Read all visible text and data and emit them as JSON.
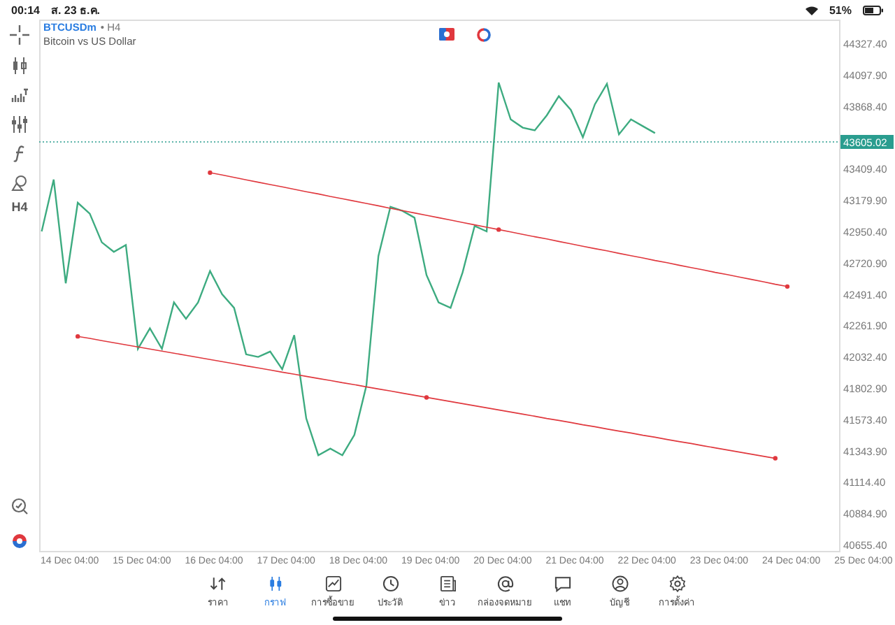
{
  "status_bar": {
    "time": "00:14",
    "date": "ส. 23 ธ.ค.",
    "battery": "51%"
  },
  "left_toolbar": {
    "timeframe": "H4"
  },
  "header": {
    "symbol": "BTCUSDm",
    "timeframe": "• H4",
    "description": "Bitcoin vs US Dollar"
  },
  "chart": {
    "chart_data": {
      "type": "line",
      "categories": [
        null,
        null,
        "14 Dec 04:00",
        null,
        null,
        null,
        null,
        null,
        "15 Dec 04:00",
        null,
        null,
        null,
        null,
        null,
        "16 Dec 04:00",
        null,
        null,
        null,
        null,
        null,
        "17 Dec 04:00",
        null,
        null,
        null,
        null,
        null,
        "18 Dec 04:00",
        null,
        null,
        null,
        null,
        null,
        "19 Dec 04:00",
        null,
        null,
        null,
        null,
        null,
        "20 Dec 04:00",
        null,
        null,
        null,
        null,
        null,
        "21 Dec 04:00",
        null,
        null,
        null,
        null,
        null,
        "22 Dec 04:00",
        null,
        null,
        null,
        null,
        null,
        "23 Dec 04:00",
        null,
        null,
        null,
        null,
        null,
        "24 Dec 04:00",
        null,
        null,
        null,
        null,
        null,
        "25 Dec 04:00"
      ],
      "series": [
        {
          "color": "#3dab80",
          "values": [
            42950,
            43330,
            42570,
            43160,
            43080,
            42870,
            42800,
            42850,
            42090,
            42240,
            42090,
            42430,
            42310,
            42430,
            42660,
            42490,
            42390,
            42050,
            42030,
            42070,
            41940,
            42190,
            41580,
            41310,
            41360,
            41310,
            41460,
            41820,
            42770,
            43130,
            43100,
            43050,
            42630,
            42430,
            42390,
            42650,
            42990,
            42950,
            44040,
            43770,
            43710,
            43690,
            43800,
            43940,
            43840,
            43640,
            43880,
            44030,
            43660,
            43770,
            43720,
            43670,
            null,
            null,
            null,
            null,
            null,
            null,
            null,
            null,
            null,
            null,
            null,
            null,
            null,
            null,
            null,
            null,
            null
          ]
        },
        {
          "color": "#e0383e",
          "values": [
            null,
            null,
            null,
            null,
            null,
            null,
            null,
            null,
            null,
            null,
            null,
            null,
            null,
            null,
            43380,
            43363,
            43345,
            43328,
            43310,
            43293,
            43276,
            43258,
            43241,
            43224,
            43206,
            43189,
            43172,
            43154,
            43137,
            43119,
            43102,
            43085,
            43067,
            43050,
            43033,
            43015,
            42998,
            42980,
            42963,
            42946,
            42928,
            42911,
            42894,
            42876,
            42859,
            42841,
            42824,
            42807,
            42789,
            42772,
            42755,
            42737,
            42720,
            42702,
            42685,
            42668,
            42650,
            42633,
            42616,
            42598,
            42581,
            42563,
            42546,
            null,
            null,
            null,
            null,
            null,
            null
          ]
        },
        {
          "color": "#e0383e",
          "values": [
            null,
            null,
            null,
            42181,
            42166,
            42150,
            42135,
            42119,
            42104,
            42089,
            42073,
            42058,
            42042,
            42027,
            42012,
            41996,
            41981,
            41965,
            41950,
            41935,
            41919,
            41904,
            41888,
            41873,
            41858,
            41842,
            41827,
            41811,
            41796,
            41781,
            41765,
            41750,
            41734,
            41719,
            41704,
            41688,
            41673,
            41657,
            41642,
            41627,
            41611,
            41596,
            41580,
            41565,
            41550,
            41534,
            41519,
            41503,
            41488,
            41473,
            41457,
            41442,
            41426,
            41411,
            41396,
            41380,
            41365,
            41349,
            41334,
            41319,
            41303,
            41288,
            null,
            null,
            null,
            null,
            null,
            null,
            null
          ]
        }
      ],
      "yticks": [
        {
          "value": 44327.4,
          "label": "44327.40"
        },
        {
          "value": 44097.9,
          "label": "44097.90"
        },
        {
          "value": 43868.4,
          "label": "43868.40"
        },
        {
          "value": 43409.4,
          "label": "43409.40"
        },
        {
          "value": 43179.9,
          "label": "43179.90"
        },
        {
          "value": 42950.4,
          "label": "42950.40"
        },
        {
          "value": 42720.9,
          "label": "42720.90"
        },
        {
          "value": 42491.4,
          "label": "42491.40"
        },
        {
          "value": 42261.9,
          "label": "42261.90"
        },
        {
          "value": 42032.4,
          "label": "42032.40"
        },
        {
          "value": 41802.9,
          "label": "41802.90"
        },
        {
          "value": 41573.4,
          "label": "41573.40"
        },
        {
          "value": 41343.9,
          "label": "41343.90"
        },
        {
          "value": 41114.4,
          "label": "41114.40"
        },
        {
          "value": 40884.9,
          "label": "40884.90"
        },
        {
          "value": 40655.4,
          "label": "40655.40"
        }
      ],
      "ylim": [
        40610,
        44501
      ],
      "ref_lines": [
        {
          "axis": "y",
          "value": 43605.02,
          "label": "43605.02",
          "color": "#2a9d8f"
        }
      ]
    }
  },
  "tabs": [
    {
      "label": "ราคา",
      "selected": false
    },
    {
      "label": "กราฟ",
      "selected": true
    },
    {
      "label": "การซื้อขาย",
      "selected": false
    },
    {
      "label": "ประวัติ",
      "selected": false
    },
    {
      "label": "ข่าว",
      "selected": false
    },
    {
      "label": "กล่องจดหมาย",
      "selected": false
    },
    {
      "label": "แชท",
      "selected": false
    },
    {
      "label": "บัญชี",
      "selected": false
    },
    {
      "label": "การตั้งค่า",
      "selected": false
    }
  ]
}
